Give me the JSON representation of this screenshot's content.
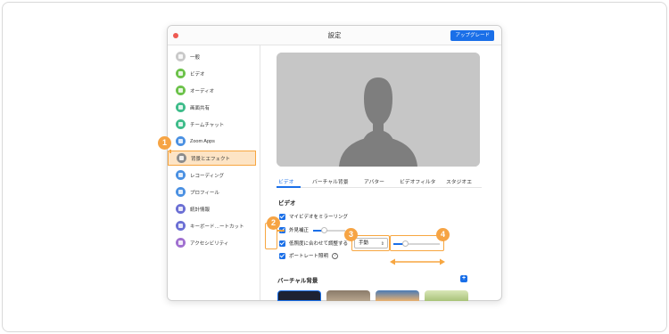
{
  "window": {
    "title": "設定",
    "upgrade_label": "アップグレード"
  },
  "sidebar": {
    "items": [
      {
        "label": "一般",
        "icon": "gear-icon",
        "color": "#c9c9c9"
      },
      {
        "label": "ビデオ",
        "icon": "video-camera-icon",
        "color": "#6cc24a"
      },
      {
        "label": "オーディオ",
        "icon": "headphones-icon",
        "color": "#6cc24a"
      },
      {
        "label": "画面共有",
        "icon": "screen-share-icon",
        "color": "#3ebc8a"
      },
      {
        "label": "チームチャット",
        "icon": "chat-bubble-icon",
        "color": "#3ebc8a"
      },
      {
        "label": "Zoom Apps",
        "icon": "apps-icon",
        "color": "#4a90e2"
      },
      {
        "label": "背景とエフェクト",
        "icon": "background-effects-icon",
        "color": "#8c8c8c"
      },
      {
        "label": "レコーディング",
        "icon": "record-icon",
        "color": "#4a90e2"
      },
      {
        "label": "プロフィール",
        "icon": "profile-icon",
        "color": "#4a90e2"
      },
      {
        "label": "統計情報",
        "icon": "statistics-icon",
        "color": "#6b6fd4"
      },
      {
        "label": "キーボード…ートカット",
        "icon": "keyboard-icon",
        "color": "#6b6fd4"
      },
      {
        "label": "アクセシビリティ",
        "icon": "accessibility-icon",
        "color": "#a070d0"
      }
    ],
    "active_index": 6
  },
  "tabs": [
    {
      "label": "ビデオ",
      "active": true
    },
    {
      "label": "バーチャル背景",
      "active": false
    },
    {
      "label": "アバター",
      "active": false
    },
    {
      "label": "ビデオフィルタ",
      "active": false
    },
    {
      "label": "スタジオエ",
      "active": false
    }
  ],
  "video_section": {
    "title": "ビデオ",
    "mirror_label": "マイビデオをミラーリング",
    "touchup_label": "外見補正",
    "lowlight_label": "低照度に合わせて調整する",
    "lowlight_mode": "手動",
    "portrait_label": "ポートレート照明",
    "info_glyph": "?",
    "touchup_level": 0.35,
    "lowlight_level": 0.25
  },
  "virtual_bg_section": {
    "title": "バーチャル背景",
    "add_glyph": "+"
  },
  "callouts": [
    "1",
    "2",
    "3",
    "4"
  ],
  "colors": {
    "accent_blue": "#1a6fe8",
    "callout_orange": "#f7a640",
    "highlight_fill": "#fde4c5"
  }
}
